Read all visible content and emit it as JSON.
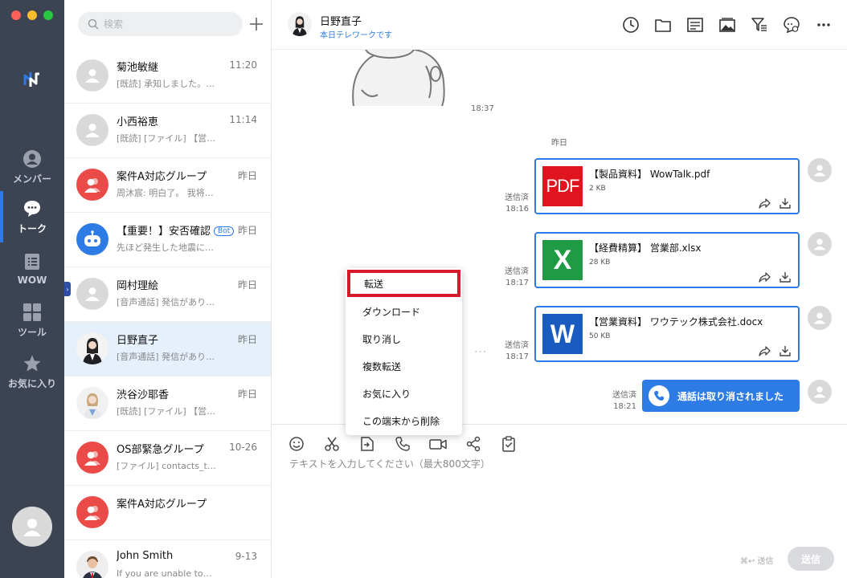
{
  "colors": {
    "rail": "#3c4353",
    "accent": "#2d7be5",
    "highlight_border": "#d7192a",
    "pdf_red": "#e0141e",
    "excel_green": "#1f9b45",
    "word_blue": "#1a5bbf"
  },
  "rail": {
    "nav": [
      {
        "label": "メンバー",
        "icon": "person-icon"
      },
      {
        "label": "トーク",
        "icon": "chat-icon",
        "active": true
      },
      {
        "label": "WOW",
        "icon": "wow-icon"
      },
      {
        "label": "ツール",
        "icon": "grid-icon"
      },
      {
        "label": "お気に入り",
        "icon": "star-icon"
      }
    ]
  },
  "sidebar": {
    "search_placeholder": "検索",
    "conversations": [
      {
        "name": "菊池敏継",
        "time": "11:20",
        "preview": "[既読] 承知しました。…"
      },
      {
        "name": "小西裕恵",
        "time": "11:14",
        "preview": "[既読] [ファイル] 【営…"
      },
      {
        "name": "案件A対応グループ",
        "time": "昨日",
        "preview": "周沐宸: 明白了。 我将…"
      },
      {
        "name": "【重要！】安否確認",
        "badge": "Bot",
        "time": "昨日",
        "preview": "先ほど発生した地震に…"
      },
      {
        "name": "岡村理絵",
        "time": "昨日",
        "preview": "[音声通話] 発信があり…"
      },
      {
        "name": "日野直子",
        "time": "昨日",
        "preview": "[音声通話] 発信があり…"
      },
      {
        "name": "渋谷沙耶香",
        "time": "昨日",
        "preview": "[既読] [ファイル] 【営…"
      },
      {
        "name": "OS部緊急グループ",
        "time": "10-26",
        "preview": "[ファイル] contacts_t…"
      },
      {
        "name": "案件A対応グループ",
        "time": "",
        "preview": ""
      },
      {
        "name": "John Smith",
        "time": "9-13",
        "preview": "If you are unable to…"
      }
    ]
  },
  "chat": {
    "contact_name": "日野直子",
    "contact_status": "本日テレワークです",
    "sticker_time": "18:37",
    "date_separator": "昨日",
    "files": [
      {
        "type": "PDF",
        "name": "【製品資料】 WowTalk.pdf",
        "size": "2 KB",
        "status": "送信済",
        "time": "18:16"
      },
      {
        "type": "X",
        "name": "【経費精算】 営業部.xlsx",
        "size": "28 KB",
        "status": "送信済",
        "time": "18:17"
      },
      {
        "type": "W",
        "name": "【営業資料】 ワウテック株式会社.docx",
        "size": "50 KB",
        "status": "送信済",
        "time": "18:17"
      }
    ],
    "call": {
      "text": "通話は取り消されました",
      "status": "送信済",
      "time": "18:21"
    },
    "input_placeholder": "テキストを入力してください（最大800文字）",
    "send_shortcut": "⌘↩ 送信",
    "send_label": "送信"
  },
  "context_menu": {
    "items": [
      "転送",
      "ダウンロード",
      "取り消し",
      "複数転送",
      "お気に入り",
      "この端末から削除"
    ]
  }
}
